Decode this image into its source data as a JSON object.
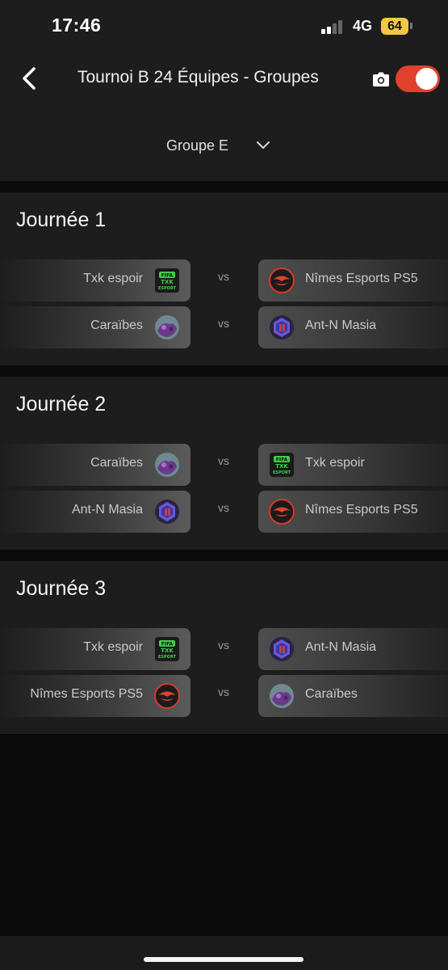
{
  "status_bar": {
    "time": "17:46",
    "network": "4G",
    "battery": "64"
  },
  "header": {
    "title": "Tournoi B 24 Équipes - Groupes",
    "toggle_on": true
  },
  "group_select": {
    "selected": "Groupe E"
  },
  "colors": {
    "accent": "#e0412d",
    "panel": "#1d1d1d",
    "background": "#0b0b0b",
    "battery": "#f2c744"
  },
  "vs_label": "vs",
  "days": [
    {
      "title": "Journée 1",
      "matches": [
        {
          "home": {
            "name": "Txk espoir",
            "logo": "txk-logo-icon"
          },
          "away": {
            "name": "Nîmes Esports PS5",
            "logo": "nimes-logo-icon"
          }
        },
        {
          "home": {
            "name": "Caraïbes",
            "logo": "caraibes-logo-icon"
          },
          "away": {
            "name": "Ant-N Masia",
            "logo": "antn-logo-icon"
          }
        }
      ]
    },
    {
      "title": "Journée 2",
      "matches": [
        {
          "home": {
            "name": "Caraïbes",
            "logo": "caraibes-logo-icon"
          },
          "away": {
            "name": "Txk espoir",
            "logo": "txk-logo-icon"
          }
        },
        {
          "home": {
            "name": "Ant-N Masia",
            "logo": "antn-logo-icon"
          },
          "away": {
            "name": "Nîmes Esports PS5",
            "logo": "nimes-logo-icon"
          }
        }
      ]
    },
    {
      "title": "Journée 3",
      "matches": [
        {
          "home": {
            "name": "Txk espoir",
            "logo": "txk-logo-icon"
          },
          "away": {
            "name": "Ant-N Masia",
            "logo": "antn-logo-icon"
          }
        },
        {
          "home": {
            "name": "Nîmes Esports PS5",
            "logo": "nimes-logo-icon"
          },
          "away": {
            "name": "Caraïbes",
            "logo": "caraibes-logo-icon"
          }
        }
      ]
    }
  ]
}
